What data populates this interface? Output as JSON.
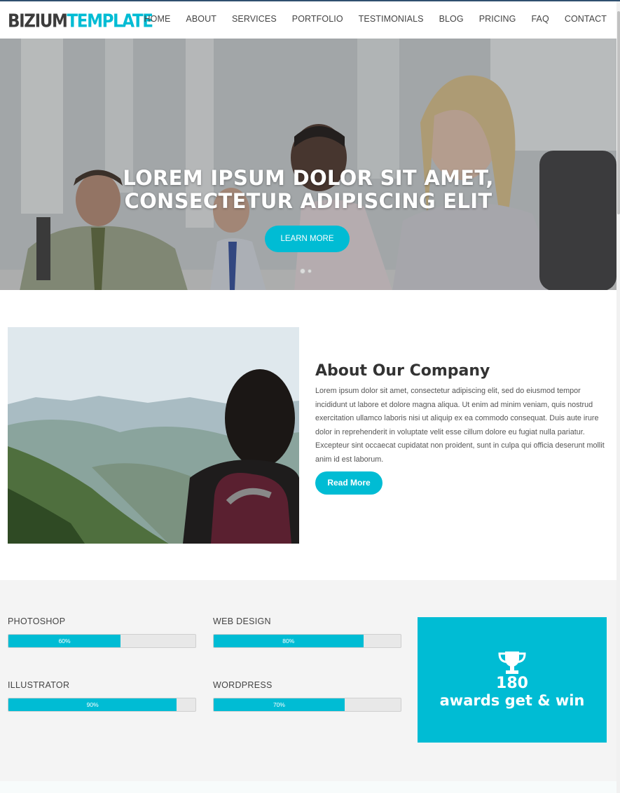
{
  "header": {
    "logo_part1": "BIZIUM",
    "logo_part2": "TEMPLATE",
    "nav": [
      "HOME",
      "ABOUT",
      "SERVICES",
      "PORTFOLIO",
      "TESTIMONIALS",
      "BLOG",
      "PRICING",
      "FAQ",
      "CONTACT"
    ]
  },
  "hero": {
    "title_line1": "LOREM IPSUM DOLOR SIT AMET,",
    "title_line2": "CONSECTETUR ADIPISCING ELIT",
    "button": "LEARN MORE"
  },
  "about": {
    "title": "About Our Company",
    "text": "Lorem ipsum dolor sit amet, consectetur adipiscing elit, sed do eiusmod tempor incididunt ut labore et dolore magna aliqua. Ut enim ad minim veniam, quis nostrud exercitation ullamco laboris nisi ut aliquip ex ea commodo consequat. Duis aute irure dolor in reprehenderit in voluptate velit esse cillum dolore eu fugiat nulla pariatur. Excepteur sint occaecat cupidatat non proident, sunt in culpa qui officia deserunt mollit anim id est laborum.",
    "button": "Read More"
  },
  "skills": [
    {
      "label": "PHOTOSHOP",
      "percent_text": "60%",
      "fraction": 0.6
    },
    {
      "label": "WEB DESIGN",
      "percent_text": "80%",
      "fraction": 0.8
    },
    {
      "label": "ILLUSTRATOR",
      "percent_text": "90%",
      "fraction": 0.9
    },
    {
      "label": "WORDPRESS",
      "percent_text": "70%",
      "fraction": 0.7
    }
  ],
  "award": {
    "icon": "trophy-icon",
    "number": "180",
    "text": "awards get & win"
  },
  "colors": {
    "accent": "#00bcd4",
    "logo_dark": "#3c3c3c",
    "skills_bg": "#f4f4f4"
  }
}
